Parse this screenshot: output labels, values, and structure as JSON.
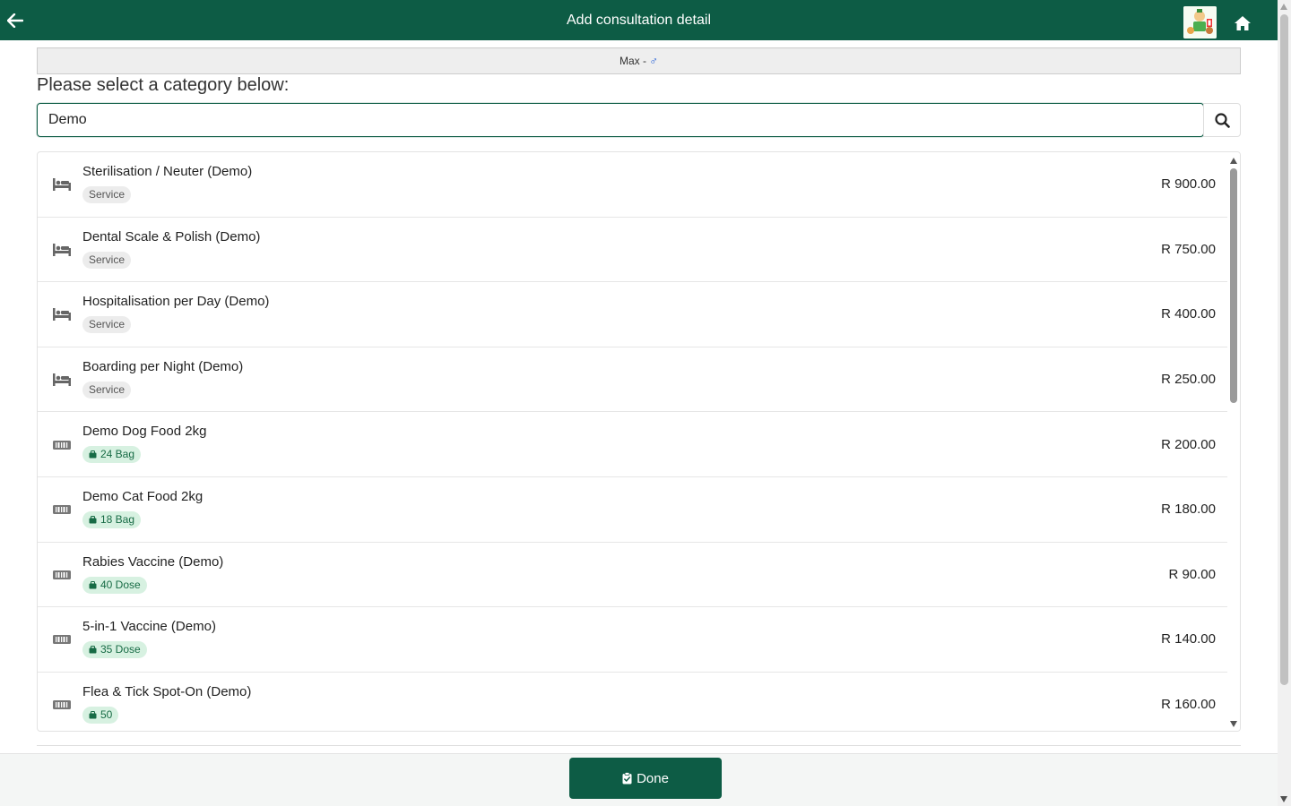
{
  "header": {
    "title": "Add consultation detail",
    "back_icon": "arrow-left-icon",
    "home_icon": "home-icon",
    "background": "#0d5c45"
  },
  "patient": {
    "label": "Max - ",
    "sex_symbol": "♂",
    "sex_color": "#1e5bd6"
  },
  "prompt": "Please select a category below:",
  "search": {
    "value": "Demo",
    "placeholder": "",
    "icon": "search-icon"
  },
  "items": [
    {
      "name": "Sterilisation / Neuter (Demo)",
      "badge": "Service",
      "badge_type": "service",
      "price": "R 900.00",
      "icon": "bed-icon"
    },
    {
      "name": "Dental Scale & Polish (Demo)",
      "badge": "Service",
      "badge_type": "service",
      "price": "R 750.00",
      "icon": "bed-icon"
    },
    {
      "name": "Hospitalisation per Day (Demo)",
      "badge": "Service",
      "badge_type": "service",
      "price": "R 400.00",
      "icon": "bed-icon"
    },
    {
      "name": "Boarding per Night (Demo)",
      "badge": "Service",
      "badge_type": "service",
      "price": "R 250.00",
      "icon": "bed-icon"
    },
    {
      "name": "Demo Dog Food 2kg",
      "badge": "24 Bag",
      "badge_type": "stock",
      "price": "R 200.00",
      "icon": "barcode-icon"
    },
    {
      "name": "Demo Cat Food 2kg",
      "badge": "18 Bag",
      "badge_type": "stock",
      "price": "R 180.00",
      "icon": "barcode-icon"
    },
    {
      "name": "Rabies Vaccine (Demo)",
      "badge": "40 Dose",
      "badge_type": "stock",
      "price": "R 90.00",
      "icon": "barcode-icon"
    },
    {
      "name": "5-in-1 Vaccine (Demo)",
      "badge": "35 Dose",
      "badge_type": "stock",
      "price": "R 140.00",
      "icon": "barcode-icon"
    },
    {
      "name": "Flea & Tick Spot-On (Demo)",
      "badge": "50",
      "badge_type": "stock",
      "price": "R 160.00",
      "icon": "barcode-icon"
    }
  ],
  "footer": {
    "done_label": "Done",
    "done_icon": "clipboard-check-icon"
  }
}
